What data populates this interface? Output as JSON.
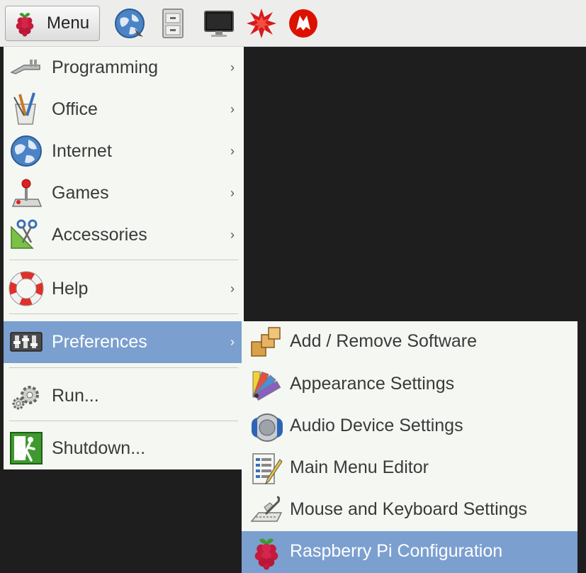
{
  "taskbar": {
    "menu_label": "Menu",
    "launchers": [
      {
        "icon": "web-browser-icon"
      },
      {
        "icon": "file-manager-icon"
      },
      {
        "icon": "terminal-icon"
      },
      {
        "icon": "mathematica-icon"
      },
      {
        "icon": "wolfram-icon"
      }
    ]
  },
  "main_menu": {
    "items": [
      {
        "label": "Programming",
        "icon": "programming-icon",
        "arrow": "›"
      },
      {
        "label": "Office",
        "icon": "office-icon",
        "arrow": "›"
      },
      {
        "label": "Internet",
        "icon": "internet-globe-icon",
        "arrow": "›"
      },
      {
        "label": "Games",
        "icon": "joystick-icon",
        "arrow": "›"
      },
      {
        "label": "Accessories",
        "icon": "accessories-icon",
        "arrow": "›"
      },
      {
        "label": "Help",
        "icon": "lifebuoy-icon",
        "arrow": "›"
      },
      {
        "label": "Preferences",
        "icon": "preferences-icon",
        "arrow": "›"
      },
      {
        "label": "Run...",
        "icon": "gears-icon"
      },
      {
        "label": "Shutdown...",
        "icon": "exit-icon"
      }
    ]
  },
  "sub_menu": {
    "items": [
      {
        "label": "Add / Remove Software",
        "icon": "packages-icon"
      },
      {
        "label": "Appearance Settings",
        "icon": "palette-icon"
      },
      {
        "label": "Audio Device Settings",
        "icon": "speaker-icon"
      },
      {
        "label": "Main Menu Editor",
        "icon": "menu-editor-icon"
      },
      {
        "label": "Mouse and Keyboard Settings",
        "icon": "mouse-keyboard-icon"
      },
      {
        "label": "Raspberry Pi Configuration",
        "icon": "raspberry-icon"
      }
    ]
  },
  "colors": {
    "highlight": "#7b9fcf",
    "menu_bg": "#f5f7f3",
    "desktop": "#1e1e1e"
  }
}
